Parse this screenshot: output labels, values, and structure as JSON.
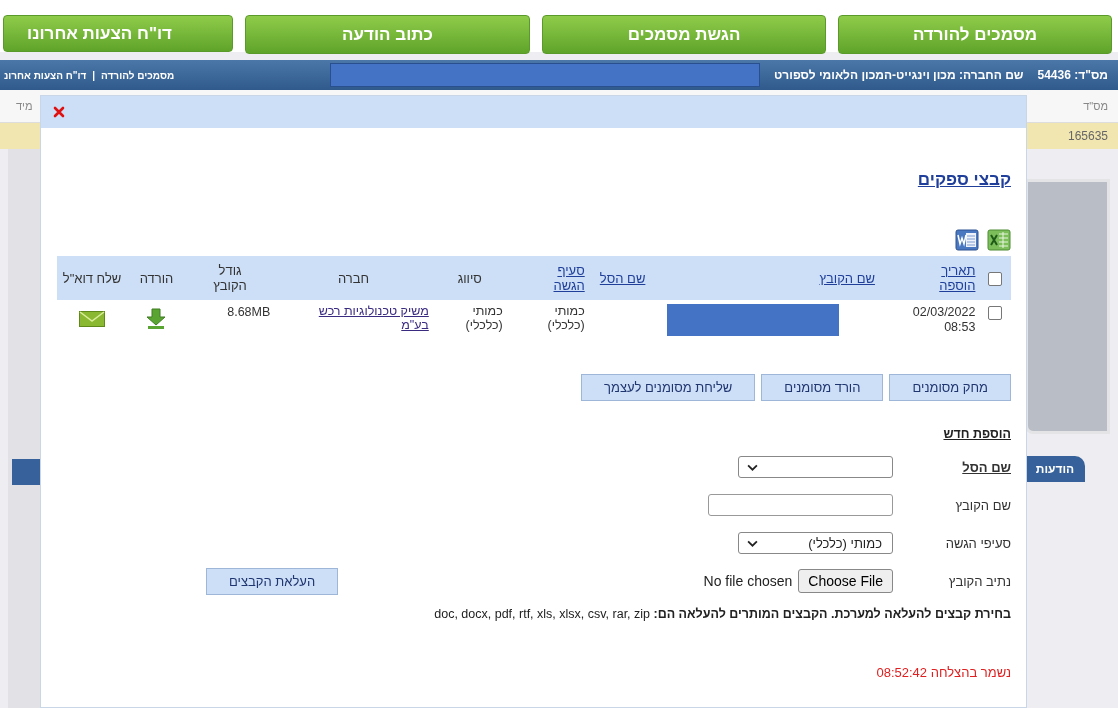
{
  "nav_tabs": [
    {
      "label": "מסמכים להורדה"
    },
    {
      "label": "הגשת מסמכים"
    },
    {
      "label": "כתוב הודעה"
    },
    {
      "label": "דו\"ח הצעות אחרונו"
    }
  ],
  "info_bar": {
    "record_id": "מס\"ד: 54436",
    "company": "שם החברה: מכון וינגייט-המכון הלאומי לספורט",
    "breadcrumb": [
      "מסמכים להורדה",
      "דו\"ח הצעות אחרונ"
    ],
    "separator": "|"
  },
  "background": {
    "column_headers": [
      "מס\"ד",
      "מיד"
    ],
    "row_value": "165635",
    "side_tab": "הודעות"
  },
  "dialog": {
    "title": "קבצי ספקים",
    "table": {
      "header_checkbox": {
        "checked": false
      },
      "columns": [
        {
          "label": "תאריך הוספה",
          "link": true
        },
        {
          "label": "שם הקובץ",
          "link": true
        },
        {
          "label": "שם הסל",
          "link": true
        },
        {
          "label": "סעיף הגשה",
          "link": true
        },
        {
          "label": "סיווג",
          "link": false
        },
        {
          "label": "חברה",
          "link": false
        },
        {
          "label": "גודל הקובץ",
          "link": false
        },
        {
          "label": "הורדה",
          "link": false
        },
        {
          "label": "שלח דוא\"ל",
          "link": false
        }
      ],
      "rows": [
        {
          "checked": false,
          "date": "02/03/2022",
          "time": "08:53",
          "section": "כמותי (כלכלי)",
          "classification": "כמותי (כלכלי)",
          "company": "משיק טכנולוגיות רכש בע\"מ",
          "size": "8.68MB"
        }
      ]
    },
    "buttons": [
      "מחק מסומנים",
      "הורד מסומנים",
      "שליחת מסומנים לעצמך"
    ],
    "add_new": {
      "heading": "הוספת חדש",
      "fields": [
        {
          "kind": "select",
          "label": "שם הסל",
          "emphasis": true
        },
        {
          "kind": "text",
          "label": "שם הקובץ",
          "emphasis": false
        },
        {
          "kind": "select",
          "label": "סעיפי הגשה",
          "emphasis": false,
          "value": "כמותי (כלכלי)"
        },
        {
          "kind": "file",
          "label": "נתיב הקובץ",
          "emphasis": false,
          "button_label": "Choose File",
          "status": "No file chosen"
        }
      ],
      "upload_button": "העלאת הקבצים",
      "instructions": "**בחירת קבצים להעלאה למערכת. הקבצים המותרים להעלאה הם:** doc, docx, pdf, rtf, xls, xlsx, csv, rar, zip",
      "status_message": "נשמר בהצלחה 08:52:42"
    }
  }
}
